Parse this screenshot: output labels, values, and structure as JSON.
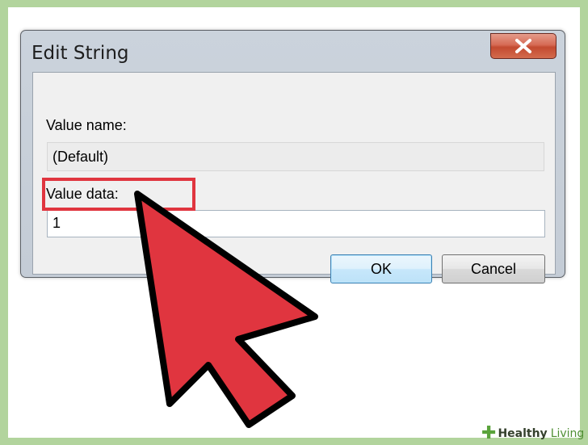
{
  "dialog": {
    "title": "Edit String",
    "value_name_label": "Value name:",
    "value_name": "(Default)",
    "value_data_label": "Value data:",
    "value_data": "1",
    "ok_label": "OK",
    "cancel_label": "Cancel"
  },
  "watermark": {
    "brand": "Healthy",
    "brand_suffix": "Living"
  },
  "colors": {
    "highlight": "#e0353f",
    "cursor_fill": "#e0353f",
    "frame": "#b2d49d"
  },
  "icons": {
    "close": "close-icon",
    "cursor": "arrow-cursor-icon",
    "watermark": "plus-icon"
  }
}
